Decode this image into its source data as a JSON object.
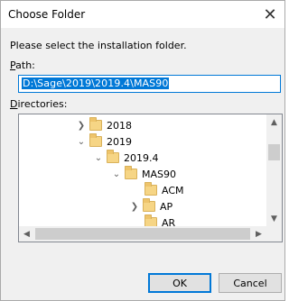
{
  "window": {
    "title": "Choose Folder",
    "close_glyph": "✕"
  },
  "prompt": "Please select the installation folder.",
  "path": {
    "label_accel": "P",
    "label_rest": "ath:",
    "value": "D:\\Sage\\2019\\2019.4\\MAS90"
  },
  "directories": {
    "label_accel": "D",
    "label_rest": "irectories:",
    "items": [
      {
        "label": "2018",
        "expander": "collapsed"
      },
      {
        "label": "2019",
        "expander": "expanded"
      },
      {
        "label": "2019.4",
        "expander": "expanded"
      },
      {
        "label": "MAS90",
        "expander": "expanded"
      },
      {
        "label": "ACM",
        "expander": "none"
      },
      {
        "label": "AP",
        "expander": "collapsed"
      },
      {
        "label": "AR",
        "expander": "none"
      }
    ]
  },
  "buttons": {
    "ok": "OK",
    "cancel": "Cancel"
  },
  "icons": {
    "folder": "folder-icon",
    "collapsed": "chevron-right-icon",
    "expanded": "chevron-down-icon"
  },
  "colors": {
    "selection": "#0078d7",
    "folder": "#f6d585"
  }
}
